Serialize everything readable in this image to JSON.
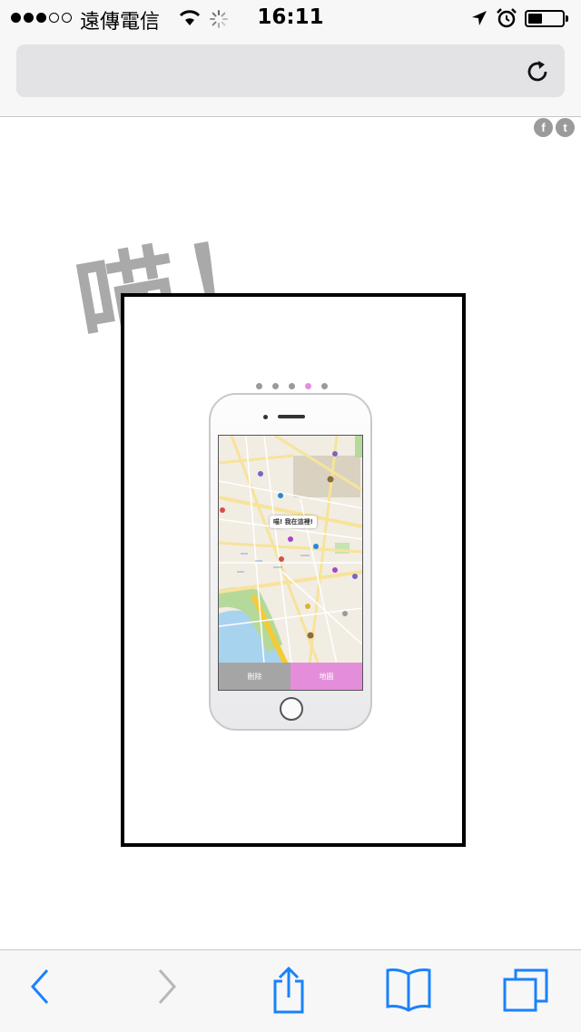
{
  "status_bar": {
    "carrier": "遠傳電信",
    "time": "16:11",
    "signal_bars_filled": 3,
    "signal_bars_total": 5,
    "battery_level": 0.35
  },
  "address_bar": {
    "url": "",
    "reload_icon": "reload-icon"
  },
  "page": {
    "share_icons": [
      "f",
      "t"
    ],
    "headline": "喵！",
    "pager": {
      "count": 5,
      "active_index": 3,
      "active_color": "#e48edb",
      "inactive_color": "#9a9a9a"
    },
    "phone_screen": {
      "map_bubble": "喵! 我在這裡!",
      "tabs": [
        {
          "label": "刪除",
          "color": "#a5a5a5"
        },
        {
          "label": "地圖",
          "color": "#e48edb"
        }
      ]
    }
  },
  "toolbar": {
    "items": [
      "back-icon",
      "forward-icon",
      "share-icon",
      "bookmarks-icon",
      "tabs-icon"
    ],
    "accent": "#1a82fb",
    "disabled": "#b8b8b8"
  }
}
